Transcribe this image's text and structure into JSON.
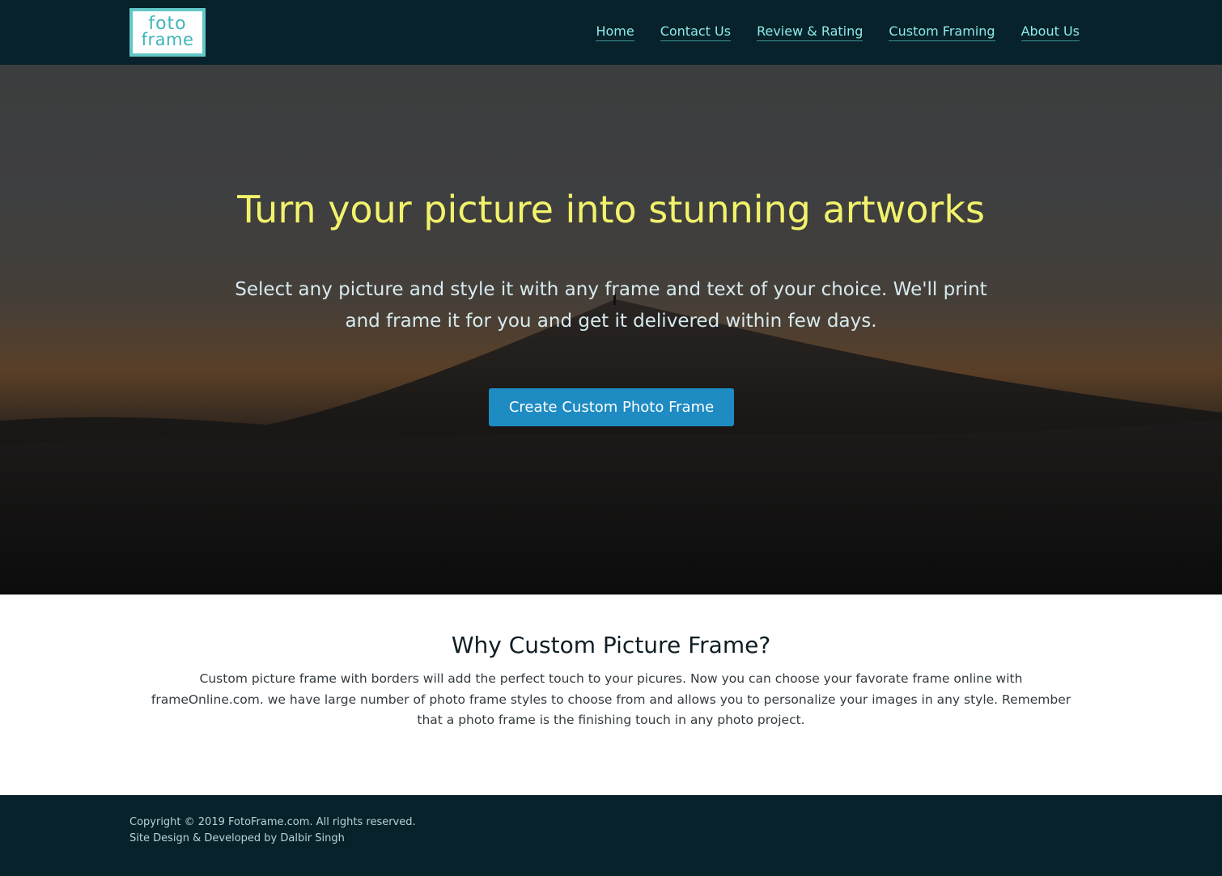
{
  "brand": {
    "logo_line1": "foto",
    "logo_line2": "frame",
    "logo_color": "#3fb5b8"
  },
  "nav": {
    "items": [
      {
        "label": "Home"
      },
      {
        "label": "Contact Us"
      },
      {
        "label": "Review & Rating"
      },
      {
        "label": "Custom Framing"
      },
      {
        "label": "About Us"
      }
    ]
  },
  "hero": {
    "title": "Turn your picture into stunning artworks",
    "subtitle": "Select any picture and style it with any frame and text of your choice. We'll print and frame it for you and get it delivered within few days.",
    "cta_label": "Create Custom Photo Frame",
    "title_color": "#f2f36b",
    "cta_color": "#1e8bc3"
  },
  "why": {
    "title": "Why Custom Picture Frame?",
    "text": "Custom picture frame with borders will add the perfect touch to your picures. Now you can choose your favorate frame online with frameOnline.com. we have large number of photo frame styles to choose from and allows you to personalize your images in any style. Remember that a photo frame is the finishing touch in any photo project."
  },
  "footer": {
    "copyright": "Copyright © 2019 FotoFrame.com. All rights reserved.",
    "credit": "Site Design & Developed by Dalbir Singh"
  },
  "colors": {
    "header_bg": "#07222a",
    "nav_link": "#8de9ea"
  }
}
